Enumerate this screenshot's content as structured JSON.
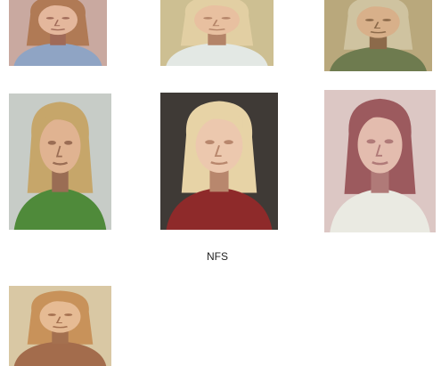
{
  "gallery": {
    "items": [
      {
        "kind": "painting",
        "bg": "#c9a9a0",
        "skin": "#e4b79c",
        "hair": "#b07a55",
        "cloth": "#8fa4c4",
        "shade": "#a06a58"
      },
      {
        "kind": "painting",
        "bg": "#cdbf92",
        "skin": "#e8c0a0",
        "hair": "#e2cfa3",
        "cloth": "#e3e8e4",
        "shade": "#b48468"
      },
      {
        "kind": "painting",
        "bg": "#b9a87c",
        "skin": "#d8b08a",
        "hair": "#cfc3a0",
        "cloth": "#6e7b4f",
        "shade": "#8c6a4a"
      },
      {
        "kind": "painting",
        "bg": "#c7ccc7",
        "skin": "#e0b391",
        "hair": "#c6a66a",
        "cloth": "#4f8a3a",
        "shade": "#9a6d54"
      },
      {
        "kind": "painting",
        "bg": "#3f3a36",
        "skin": "#ecc8ae",
        "hair": "#e7d3a6",
        "cloth": "#8e2a2a",
        "shade": "#b8876d"
      },
      {
        "kind": "painting",
        "bg": "#dcc7c4",
        "skin": "#e3bcae",
        "hair": "#9c5a5e",
        "cloth": "#eaeae2",
        "shade": "#b07a78"
      },
      {
        "kind": "painting",
        "bg": "#d9c8a4",
        "skin": "#e6bb94",
        "hair": "#c8925a",
        "cloth": "#a36c4c",
        "shade": "#a4704f"
      }
    ],
    "captions": {
      "nfs": "NFS"
    }
  }
}
